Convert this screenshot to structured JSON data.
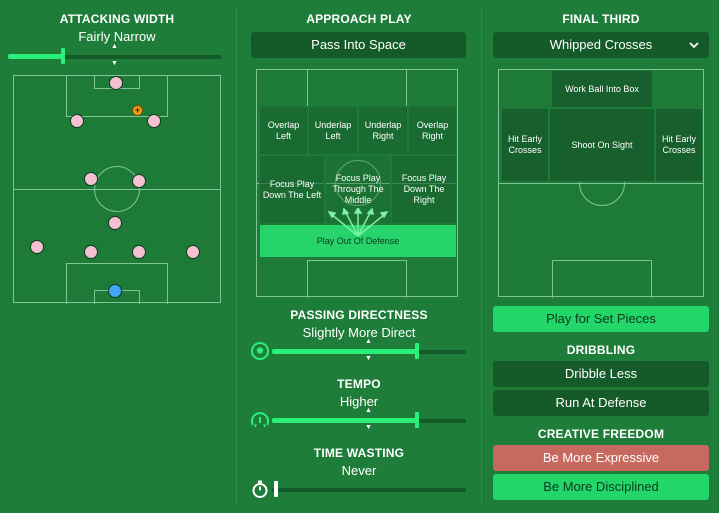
{
  "attacking_width": {
    "title": "ATTACKING WIDTH",
    "value": "Fairly Narrow",
    "level": 0.27
  },
  "approach_play": {
    "title": "APPROACH PLAY",
    "selected": "Pass Into Space",
    "zones": {
      "overlap_left": "Overlap Left",
      "underlap_left": "Underlap Left",
      "underlap_right": "Underlap Right",
      "overlap_right": "Overlap Right",
      "focus_left": "Focus Play Down The Left",
      "focus_middle": "Focus Play Through The Middle",
      "focus_right": "Focus Play Down The Right",
      "play_out": "Play Out Of Defense"
    }
  },
  "passing_directness": {
    "title": "PASSING DIRECTNESS",
    "value": "Slightly More Direct",
    "level": 0.68
  },
  "tempo": {
    "title": "TEMPO",
    "value": "Higher",
    "level": 0.68
  },
  "time_wasting": {
    "title": "TIME WASTING",
    "value": "Never",
    "level": 0.0
  },
  "final_third": {
    "title": "FINAL THIRD",
    "selected": "Whipped Crosses",
    "zones": {
      "work_ball": "Work Ball Into Box",
      "hit_early_left": "Hit Early Crosses",
      "shoot": "Shoot On Sight",
      "hit_early_right": "Hit Early Crosses"
    },
    "set_pieces": "Play for Set Pieces"
  },
  "dribbling": {
    "title": "DRIBBLING",
    "less": "Dribble Less",
    "run": "Run At Defense"
  },
  "creative_freedom": {
    "title": "CREATIVE FREEDOM",
    "expressive": "Be More Expressive",
    "disciplined": "Be More Disciplined"
  },
  "icons": {
    "chevron": "chevron-down-icon",
    "ball": "football-icon",
    "tempo": "speedometer-icon",
    "timer": "stopwatch-icon",
    "captain": "captain-icon"
  },
  "colors": {
    "background": "#1f7d3a",
    "accent": "#2af07a",
    "dark_button": "#155b2a",
    "bright_button": "#22d66a",
    "expressive": "#c7695f",
    "player": "#f4c0d2",
    "goalkeeper": "#42a5f5"
  }
}
